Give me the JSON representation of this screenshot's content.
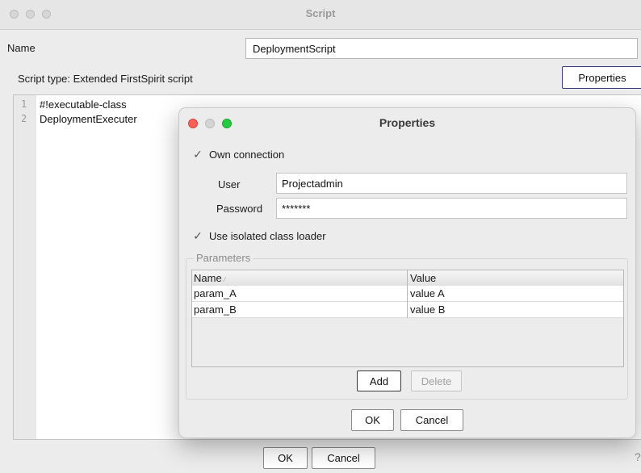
{
  "window": {
    "title": "Script",
    "name_label": "Name",
    "name_value": "DeploymentScript",
    "script_type": "Script type:  Extended FirstSpirit script",
    "properties_button": "Properties",
    "editor": {
      "lines": [
        {
          "number": "1",
          "text": "#!executable-class"
        },
        {
          "number": "2",
          "text": "DeploymentExecuter"
        }
      ]
    },
    "ok_button": "OK",
    "cancel_button": "Cancel",
    "help_glyph": "?"
  },
  "dialog": {
    "title": "Properties",
    "own_connection_label": "Own connection",
    "user_label": "User",
    "user_value": "Projectadmin",
    "password_label": "Password",
    "password_value": "*******",
    "isolated_loader_label": "Use isolated class loader",
    "parameters_legend": "Parameters",
    "table": {
      "columns": [
        "Name",
        "Value"
      ],
      "rows": [
        [
          "param_A",
          "value A"
        ],
        [
          "param_B",
          "value B"
        ]
      ]
    },
    "add_button": "Add",
    "delete_button": "Delete",
    "ok_button": "OK",
    "cancel_button": "Cancel"
  },
  "icons": {
    "check": "check-icon",
    "sort": "sort-arrow-icon"
  },
  "colors": {
    "close": "#fe5f57",
    "minimize": "#d4d4d4",
    "zoom": "#28c840",
    "inactive_traffic": "#d6d6d6"
  }
}
